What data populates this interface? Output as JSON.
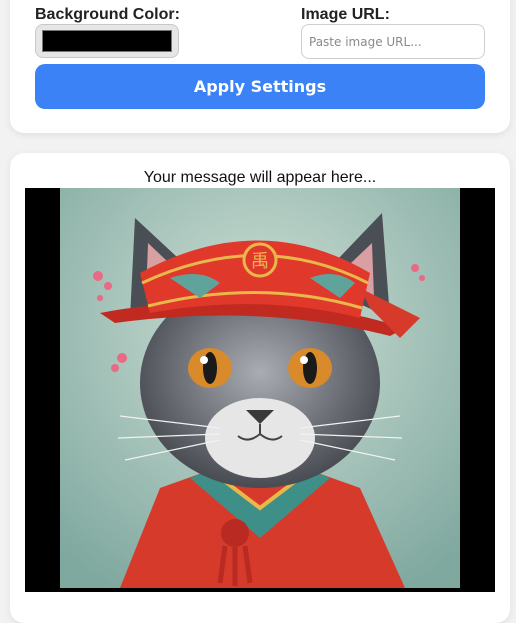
{
  "settings": {
    "background_color_label": "Background Color:",
    "background_color_value": "#000000",
    "image_url_label": "Image URL:",
    "image_url_placeholder": "Paste image URL...",
    "image_url_value": "",
    "apply_label": "Apply Settings"
  },
  "preview": {
    "message": "Your message will appear here...",
    "hat_seal_text": "禹"
  },
  "colors": {
    "accent": "#3b82f6",
    "preview_background": "#000000",
    "image_backdrop": "#8fb3ab",
    "robe": "#d63a2a",
    "hat": "#e0392b",
    "fur": "#5b5f66",
    "eyes": "#d98a2a"
  }
}
